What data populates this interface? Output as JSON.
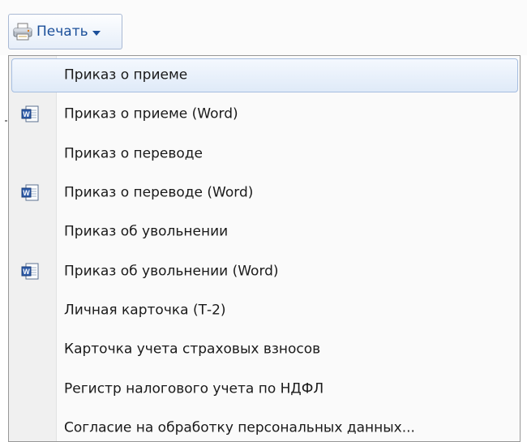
{
  "toolbar": {
    "print_label": "Печать",
    "print_icon": "printer-icon",
    "dropdown_icon": "chevron-down-icon"
  },
  "menu": {
    "items": [
      {
        "label": "Приказ о приеме",
        "icon": null,
        "highlighted": true
      },
      {
        "label": "Приказ о приеме (Word)",
        "icon": "word-document-icon",
        "highlighted": false
      },
      {
        "label": "Приказ о переводе",
        "icon": null,
        "highlighted": false
      },
      {
        "label": "Приказ о переводе (Word)",
        "icon": "word-document-icon",
        "highlighted": false
      },
      {
        "label": "Приказ об увольнении",
        "icon": null,
        "highlighted": false
      },
      {
        "label": "Приказ об увольнении (Word)",
        "icon": "word-document-icon",
        "highlighted": false
      },
      {
        "label": "Личная карточка (Т-2)",
        "icon": null,
        "highlighted": false
      },
      {
        "label": "Карточка учета страховых взносов",
        "icon": null,
        "highlighted": false
      },
      {
        "label": "Регистр налогового учета по НДФЛ",
        "icon": null,
        "highlighted": false
      },
      {
        "label": "Согласие на обработку персональных данных...",
        "icon": null,
        "highlighted": false
      }
    ]
  },
  "colors": {
    "accent_text": "#1b4f9a",
    "highlight_border": "#a5bde0",
    "highlight_fill": "#dfeaf8"
  }
}
